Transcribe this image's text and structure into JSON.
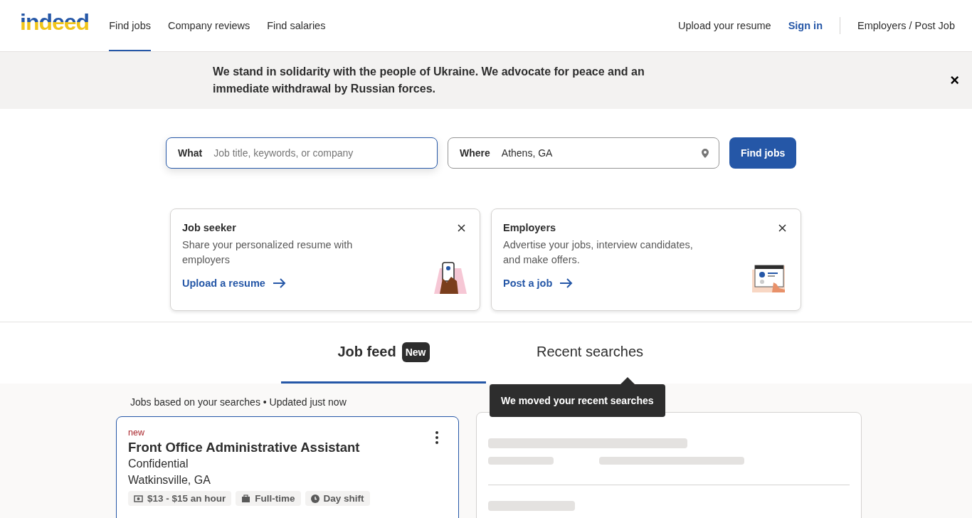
{
  "header": {
    "logo": "indeed",
    "nav": [
      {
        "label": "Find jobs",
        "selected": true
      },
      {
        "label": "Company reviews",
        "selected": false
      },
      {
        "label": "Find salaries",
        "selected": false
      }
    ],
    "right_links": [
      {
        "label": "Upload your resume",
        "kind": "plain"
      },
      {
        "label": "Sign in",
        "kind": "primary"
      },
      {
        "label": "Employers / Post Job",
        "kind": "divided"
      }
    ]
  },
  "banner": {
    "text": "We stand in solidarity with the people of Ukraine. We advocate for peace and an immediate withdrawal by Russian forces.",
    "close": "×"
  },
  "search": {
    "what": {
      "label": "What",
      "placeholder": "Job title, keywords, or company"
    },
    "where": {
      "label": "Where",
      "value": "Athens, GA"
    },
    "button": "Find jobs"
  },
  "promos": [
    {
      "title": "Job seeker",
      "text": "Share your personalized resume with employers",
      "link": "Upload a resume",
      "kind": "seeker"
    },
    {
      "title": "Employers",
      "text": "Advertise your jobs, interview candidates, and make offers.",
      "link": "Post a job",
      "kind": "employer"
    }
  ],
  "tabs": [
    {
      "label": "Job feed",
      "badge": "New",
      "selected": true
    },
    {
      "label": "Recent searches",
      "selected": false
    }
  ],
  "tooltip": "We moved your recent searches",
  "feed_note": "Jobs based on your searches • Updated just now",
  "jobs": [
    {
      "flag": "new",
      "title": "Front Office Administrative Assistant",
      "company": "Confidential",
      "location": "Watkinsville, GA",
      "tags": [
        {
          "label": "$13 - $15 an hour",
          "kind": "pay"
        },
        {
          "label": "Full-time",
          "kind": "type"
        },
        {
          "label": "Day shift",
          "kind": "shift"
        }
      ]
    }
  ]
}
